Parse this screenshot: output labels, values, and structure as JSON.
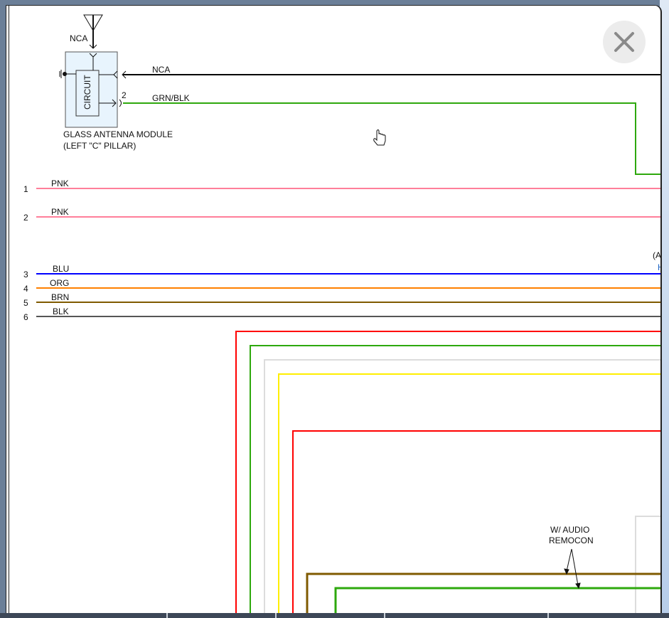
{
  "diagram": {
    "module": {
      "label_line1": "GLASS ANTENNA MODULE",
      "label_line2": "(LEFT \"C\" PILLAR)",
      "inner_label": "CIRCUIT",
      "antenna_label": "NCA",
      "pin2": "2"
    },
    "top_wires": [
      {
        "label": "NCA",
        "color": "#000000"
      },
      {
        "label": "GRN/BLK",
        "color": "#2ea80d"
      }
    ],
    "numbered_wires": [
      {
        "num": "1",
        "label": "PNK",
        "color": "#ff7f9a"
      },
      {
        "num": "2",
        "label": "PNK",
        "color": "#ff7f9a"
      },
      {
        "num": "3",
        "label": "BLU",
        "color": "#0000ff"
      },
      {
        "num": "4",
        "label": "ORG",
        "color": "#ff8000"
      },
      {
        "num": "5",
        "label": "BRN",
        "color": "#7f5a00"
      },
      {
        "num": "6",
        "label": "BLK",
        "color": "#555555"
      }
    ],
    "partial_right_text": "(A",
    "partial_right_text2": "H",
    "annotation_line1": "W/ AUDIO",
    "annotation_line2": "REMOCON"
  },
  "modal": {
    "close_icon": "close-x-icon"
  }
}
